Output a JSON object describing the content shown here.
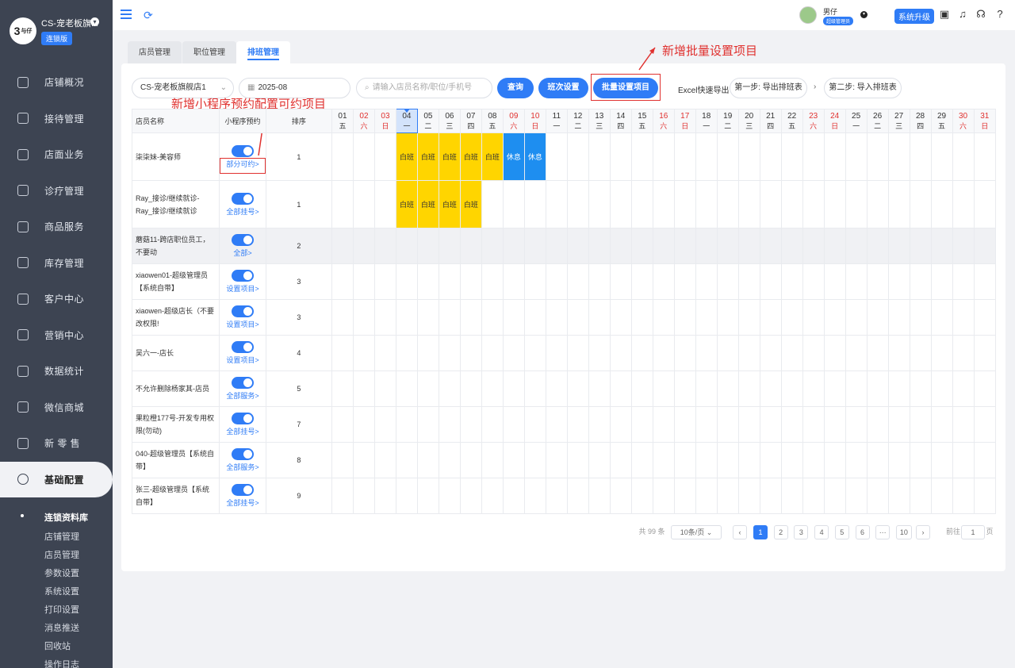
{
  "sidebar": {
    "logo_text": "与仔",
    "store_name": "CS-宠老板旗...",
    "chain_badge": "连锁版",
    "items": [
      {
        "label": "店铺概况",
        "icon": "monitor-icon"
      },
      {
        "label": "接待管理",
        "icon": "reception-icon"
      },
      {
        "label": "店面业务",
        "icon": "store-icon"
      },
      {
        "label": "诊疗管理",
        "icon": "medical-icon"
      },
      {
        "label": "商品服务",
        "icon": "goods-icon"
      },
      {
        "label": "库存管理",
        "icon": "inventory-icon"
      },
      {
        "label": "客户中心",
        "icon": "customer-icon"
      },
      {
        "label": "营销中心",
        "icon": "marketing-icon"
      },
      {
        "label": "数据统计",
        "icon": "stats-icon"
      },
      {
        "label": "微信商城",
        "icon": "wechat-icon"
      },
      {
        "label": "新 零 售",
        "icon": "retail-icon"
      },
      {
        "label": "基础配置",
        "icon": "settings-icon"
      }
    ],
    "sub_head": "连锁资料库",
    "sub_items": [
      "店铺管理",
      "店员管理",
      "参数设置",
      "系统设置",
      "打印设置",
      "消息推送",
      "回收站",
      "操作日志"
    ]
  },
  "header": {
    "user_name": "男仔",
    "user_role": "超级管理员",
    "upgrade": "系统升级"
  },
  "tabs": [
    "店员管理",
    "职位管理",
    "排班管理"
  ],
  "toolbar": {
    "store_select": "CS-宠老板旗舰店1",
    "month": "2025-08",
    "search_placeholder": "请输入店员名称/职位/手机号",
    "query": "查询",
    "shift_settings": "班次设置",
    "batch_settings": "批量设置项目",
    "excel_label": "Excel快速导出",
    "step1": "第一步: 导出排班表",
    "step2": "第二步: 导入排班表"
  },
  "annotations": {
    "batch": "新增批量设置项目",
    "mini": "新增小程序预约配置可约项目"
  },
  "table": {
    "headers": {
      "name": "店员名称",
      "mini": "小程序预约",
      "order": "排序"
    },
    "days": [
      {
        "d": "01",
        "w": "五",
        "wk": false
      },
      {
        "d": "02",
        "w": "六",
        "wk": true
      },
      {
        "d": "03",
        "w": "日",
        "wk": true
      },
      {
        "d": "04",
        "w": "一",
        "wk": false
      },
      {
        "d": "05",
        "w": "二",
        "wk": false
      },
      {
        "d": "06",
        "w": "三",
        "wk": false
      },
      {
        "d": "07",
        "w": "四",
        "wk": false
      },
      {
        "d": "08",
        "w": "五",
        "wk": false
      },
      {
        "d": "09",
        "w": "六",
        "wk": true
      },
      {
        "d": "10",
        "w": "日",
        "wk": true
      },
      {
        "d": "11",
        "w": "一",
        "wk": false
      },
      {
        "d": "12",
        "w": "二",
        "wk": false
      },
      {
        "d": "13",
        "w": "三",
        "wk": false
      },
      {
        "d": "14",
        "w": "四",
        "wk": false
      },
      {
        "d": "15",
        "w": "五",
        "wk": false
      },
      {
        "d": "16",
        "w": "六",
        "wk": true
      },
      {
        "d": "17",
        "w": "日",
        "wk": true
      },
      {
        "d": "18",
        "w": "一",
        "wk": false
      },
      {
        "d": "19",
        "w": "二",
        "wk": false
      },
      {
        "d": "20",
        "w": "三",
        "wk": false
      },
      {
        "d": "21",
        "w": "四",
        "wk": false
      },
      {
        "d": "22",
        "w": "五",
        "wk": false
      },
      {
        "d": "23",
        "w": "六",
        "wk": true
      },
      {
        "d": "24",
        "w": "日",
        "wk": true
      },
      {
        "d": "25",
        "w": "一",
        "wk": false
      },
      {
        "d": "26",
        "w": "二",
        "wk": false
      },
      {
        "d": "27",
        "w": "三",
        "wk": false
      },
      {
        "d": "28",
        "w": "四",
        "wk": false
      },
      {
        "d": "29",
        "w": "五",
        "wk": false
      },
      {
        "d": "30",
        "w": "六",
        "wk": true
      },
      {
        "d": "31",
        "w": "日",
        "wk": true
      }
    ],
    "today_index": 3,
    "rows": [
      {
        "name": "柒柒妹-美容师",
        "link": "部分可约>",
        "order": "1",
        "shifts": {
          "4": "白班",
          "5": "白班",
          "6": "白班",
          "7": "白班",
          "8": "白班",
          "9": "休息",
          "10": "休息"
        }
      },
      {
        "name": "Ray_接诊/继续就诊-Ray_接诊/继续就诊",
        "link": "全部挂号>",
        "order": "1",
        "shifts": {
          "4": "白班",
          "5": "白班",
          "6": "白班",
          "7": "白班"
        }
      },
      {
        "name": "蘑菇11-跨店职位员工，不要动",
        "link": "全部>",
        "order": "2",
        "shifts": {}
      },
      {
        "name": "xiaowen01-超级管理员【系统自带】",
        "link": "设置项目>",
        "order": "3",
        "shifts": {}
      },
      {
        "name": "xiaowen-超级店长（不要改权限!",
        "link": "设置项目>",
        "order": "3",
        "shifts": {}
      },
      {
        "name": "吴六一-店长",
        "link": "设置项目>",
        "order": "4",
        "shifts": {}
      },
      {
        "name": "不允许删除杨家其-店员",
        "link": "全部服务>",
        "order": "5",
        "shifts": {}
      },
      {
        "name": "果粒橙177号-开发专用权限(勿动)",
        "link": "全部挂号>",
        "order": "7",
        "shifts": {}
      },
      {
        "name": "040-超级管理员【系统自带】",
        "link": "全部服务>",
        "order": "8",
        "shifts": {}
      },
      {
        "name": "张三-超级管理员【系统自带】",
        "link": "全部挂号>",
        "order": "9",
        "shifts": {}
      }
    ]
  },
  "pagination": {
    "total": "共 99 条",
    "per_page": "10条/页",
    "pages": [
      "1",
      "2",
      "3",
      "4",
      "5",
      "6",
      "···",
      "10"
    ],
    "goto_label": "前往",
    "goto_value": "1",
    "page_unit": "页"
  },
  "colors": {
    "accent": "#2f7cf6",
    "work": "#ffd500",
    "rest": "#1e8ef0",
    "annotation": "#e0312f"
  }
}
